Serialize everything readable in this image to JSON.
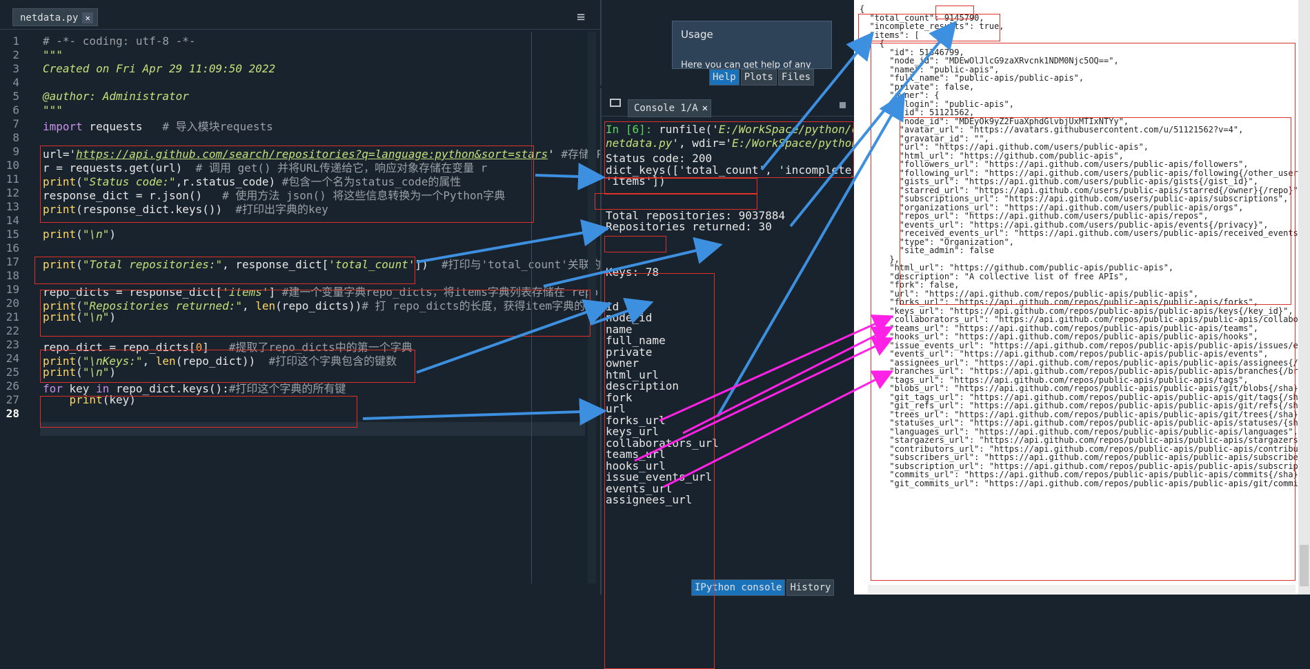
{
  "editor": {
    "tab_label": "netdata.py",
    "close_glyph": "✕",
    "menu_glyph": "≡",
    "line_numbers": [
      "1",
      "2",
      "3",
      "4",
      "5",
      "6",
      "7",
      "8",
      "9",
      "10",
      "11",
      "12",
      "13",
      "14",
      "15",
      "16",
      "17",
      "18",
      "19",
      "20",
      "21",
      "22",
      "23",
      "24",
      "25",
      "26",
      "27",
      "28"
    ],
    "lines": [
      [
        {
          "t": "# -*- coding: utf-8 -*-",
          "c": "cm"
        }
      ],
      [
        {
          "t": "\"\"\"",
          "c": "str"
        }
      ],
      [
        {
          "t": "Created on Fri Apr 29 11:09:50 2022",
          "c": "str"
        }
      ],
      [],
      [
        {
          "t": "@author: Administrator",
          "c": "str"
        }
      ],
      [
        {
          "t": "\"\"\"",
          "c": "str"
        }
      ],
      [
        {
          "t": "import",
          "c": "kw"
        },
        {
          "t": " requests   "
        },
        {
          "t": "# 导入模块requests",
          "c": "cm"
        }
      ],
      [],
      [
        {
          "t": "url="
        },
        {
          "t": "'"
        },
        {
          "t": "https://api.github.com/search/repositories?q=language:python&sort=stars",
          "c": "url"
        },
        {
          "t": "'"
        },
        {
          "t": " #存储API调",
          "c": "cm"
        }
      ],
      [
        {
          "t": "r = requests.get(url)  "
        },
        {
          "t": "# 调用 get() 并将URL传递给它，响应对象存储在变量 r",
          "c": "cm"
        }
      ],
      [
        {
          "t": "print",
          "c": "fn"
        },
        {
          "t": "("
        },
        {
          "t": "\"Status code:\"",
          "c": "str"
        },
        {
          "t": ",r.status_code) "
        },
        {
          "t": "#包含一个名为status_code的属性",
          "c": "cm"
        }
      ],
      [
        {
          "t": "response_dict = r.json()   "
        },
        {
          "t": "# 使用方法 json() 将这些信息转换为一个Python字典",
          "c": "cm"
        }
      ],
      [
        {
          "t": "print",
          "c": "fn"
        },
        {
          "t": "(response_dict.keys())  "
        },
        {
          "t": "#打印出字典的key",
          "c": "cm"
        }
      ],
      [],
      [
        {
          "t": "print",
          "c": "fn"
        },
        {
          "t": "("
        },
        {
          "t": "\"\\n\"",
          "c": "str"
        },
        {
          "t": ")"
        }
      ],
      [],
      [
        {
          "t": "print",
          "c": "fn"
        },
        {
          "t": "("
        },
        {
          "t": "\"Total repositories:\"",
          "c": "str"
        },
        {
          "t": ", response_dict["
        },
        {
          "t": "'total_count'",
          "c": "str"
        },
        {
          "t": "])  "
        },
        {
          "t": "#打印与'total_count'关联的值",
          "c": "cm"
        }
      ],
      [],
      [
        {
          "t": "repo_dicts = response_dict["
        },
        {
          "t": "'items'",
          "c": "str"
        },
        {
          "t": "] "
        },
        {
          "t": "#建一个变量字典repo_dicts，将items字典列表存储在 repo",
          "c": "cm"
        }
      ],
      [
        {
          "t": "print",
          "c": "fn"
        },
        {
          "t": "("
        },
        {
          "t": "\"Repositories returned:\"",
          "c": "str"
        },
        {
          "t": ", "
        },
        {
          "t": "len",
          "c": "fn"
        },
        {
          "t": "(repo_dicts))"
        },
        {
          "t": "# 打 repo_dicts的长度，获得item字典的长度",
          "c": "cm"
        }
      ],
      [
        {
          "t": "print",
          "c": "fn"
        },
        {
          "t": "("
        },
        {
          "t": "\"\\n\"",
          "c": "str"
        },
        {
          "t": ")"
        }
      ],
      [],
      [
        {
          "t": "repo_dict = repo_dicts["
        },
        {
          "t": "0",
          "c": "num"
        },
        {
          "t": "]   "
        },
        {
          "t": "#提取了repo_dicts中的第一个字典",
          "c": "cm"
        }
      ],
      [
        {
          "t": "print",
          "c": "fn"
        },
        {
          "t": "("
        },
        {
          "t": "\"\\nKeys:\"",
          "c": "str"
        },
        {
          "t": ", "
        },
        {
          "t": "len",
          "c": "fn"
        },
        {
          "t": "(repo_dict))  "
        },
        {
          "t": "#打印这个字典包含的键数",
          "c": "cm"
        }
      ],
      [
        {
          "t": "print",
          "c": "fn"
        },
        {
          "t": "("
        },
        {
          "t": "\"\\n\"",
          "c": "str"
        },
        {
          "t": ")"
        }
      ],
      [
        {
          "t": "for",
          "c": "kw"
        },
        {
          "t": " key "
        },
        {
          "t": "in",
          "c": "kw"
        },
        {
          "t": " repo_dict.keys():"
        },
        {
          "t": "#打印这个字典的所有键",
          "c": "cm"
        }
      ],
      [
        {
          "t": "    "
        },
        {
          "t": "print",
          "c": "fn"
        },
        {
          "t": "(key)"
        }
      ],
      []
    ]
  },
  "help": {
    "title": "Usage",
    "text": "Here you can get help of any",
    "tabs": [
      "Help",
      "Plots",
      "Files"
    ]
  },
  "console": {
    "tab_label": "Console 1/A",
    "close_glyph": "✕",
    "bottom_tabs": [
      "IPython console",
      "History"
    ],
    "run_line1_prompt": "In [6]:",
    "run_line1_rest": " runfile('",
    "run_line1_path": "E:/WorkSpace/python/cod",
    "run_line2_path": "netdata.py",
    "run_line2_mid": "', wdir='",
    "run_line2_wdir": "E:/WorkSpace/python/c",
    "output": [
      "Status code: 200",
      "dict_keys(['total_count', 'incomplete_re",
      "'items'])",
      "",
      "",
      "Total repositories: 9037884",
      "Repositories returned: 30",
      "",
      "",
      "",
      "Keys: 78",
      "",
      "",
      "id",
      "node_id",
      "name",
      "full_name",
      "private",
      "owner",
      "html_url",
      "description",
      "fork",
      "url",
      "forks_url",
      "keys_url",
      "collaborators_url",
      "teams_url",
      "hooks_url",
      "issue_events_url",
      "events_url",
      "assignees_url"
    ]
  },
  "json": {
    "lines": [
      "{",
      "  \"total_count\": 9145790,",
      "  \"incomplete_results\": true,",
      "  \"items\": [",
      "    {",
      "      \"id\": 51346799,",
      "      \"node_id\": \"MDEwOlJlcG9zaXRvcnk1NDM0Njc5OQ==\",",
      "      \"name\": \"public-apis\",",
      "      \"full_name\": \"public-apis/public-apis\",",
      "      \"private\": false,",
      "      \"owner\": {",
      "        \"login\": \"public-apis\",",
      "        \"id\": 51121562,",
      "        \"node_id\": \"MDEyOk9yZ2FuaXphdGlvbjUxMTIxNTYy\",",
      "        \"avatar_url\": \"https://avatars.githubusercontent.com/u/51121562?v=4\",",
      "        \"gravatar_id\": \"\",",
      "        \"url\": \"https://api.github.com/users/public-apis\",",
      "        \"html_url\": \"https://github.com/public-apis\",",
      "        \"followers_url\": \"https://api.github.com/users/public-apis/followers\",",
      "        \"following_url\": \"https://api.github.com/users/public-apis/following{/other_user}\",",
      "        \"gists_url\": \"https://api.github.com/users/public-apis/gists{/gist_id}\",",
      "        \"starred_url\": \"https://api.github.com/users/public-apis/starred{/owner}{/repo}\",",
      "        \"subscriptions_url\": \"https://api.github.com/users/public-apis/subscriptions\",",
      "        \"organizations_url\": \"https://api.github.com/users/public-apis/orgs\",",
      "        \"repos_url\": \"https://api.github.com/users/public-apis/repos\",",
      "        \"events_url\": \"https://api.github.com/users/public-apis/events{/privacy}\",",
      "        \"received_events_url\": \"https://api.github.com/users/public-apis/received_events\",",
      "        \"type\": \"Organization\",",
      "        \"site_admin\": false",
      "      },",
      "      \"html_url\": \"https://github.com/public-apis/public-apis\",",
      "      \"description\": \"A collective list of free APIs\",",
      "      \"fork\": false,",
      "      \"url\": \"https://api.github.com/repos/public-apis/public-apis\",",
      "      \"forks_url\": \"https://api.github.com/repos/public-apis/public-apis/forks\",",
      "      \"keys_url\": \"https://api.github.com/repos/public-apis/public-apis/keys{/key_id}\",",
      "      \"collaborators_url\": \"https://api.github.com/repos/public-apis/public-apis/collaborators\",",
      "      \"teams_url\": \"https://api.github.com/repos/public-apis/public-apis/teams\",",
      "      \"hooks_url\": \"https://api.github.com/repos/public-apis/public-apis/hooks\",",
      "      \"issue_events_url\": \"https://api.github.com/repos/public-apis/public-apis/issues/events\",",
      "      \"events_url\": \"https://api.github.com/repos/public-apis/public-apis/events\",",
      "      \"assignees_url\": \"https://api.github.com/repos/public-apis/public-apis/assignees{/user}\",",
      "      \"branches_url\": \"https://api.github.com/repos/public-apis/public-apis/branches{/branch}\",",
      "      \"tags_url\": \"https://api.github.com/repos/public-apis/public-apis/tags\",",
      "      \"blobs_url\": \"https://api.github.com/repos/public-apis/public-apis/git/blobs{/sha}\",",
      "      \"git_tags_url\": \"https://api.github.com/repos/public-apis/public-apis/git/tags{/sha}\",",
      "      \"git_refs_url\": \"https://api.github.com/repos/public-apis/public-apis/git/refs{/sha}\",",
      "      \"trees_url\": \"https://api.github.com/repos/public-apis/public-apis/git/trees{/sha}\",",
      "      \"statuses_url\": \"https://api.github.com/repos/public-apis/public-apis/statuses/{sha}\",",
      "      \"languages_url\": \"https://api.github.com/repos/public-apis/public-apis/languages\",",
      "      \"stargazers_url\": \"https://api.github.com/repos/public-apis/public-apis/stargazers\",",
      "      \"contributors_url\": \"https://api.github.com/repos/public-apis/public-apis/contributors\",",
      "      \"subscribers_url\": \"https://api.github.com/repos/public-apis/public-apis/subscribers\",",
      "      \"subscription_url\": \"https://api.github.com/repos/public-apis/public-apis/subscription\",",
      "      \"commits_url\": \"https://api.github.com/repos/public-apis/public-apis/commits{/sha}\",",
      "      \"git_commits_url\": \"https://api.github.com/repos/public-apis/public-apis/git/commits{/sha}\","
    ]
  },
  "colors": {
    "annotation_box": "#e0302a",
    "arrow_blue": "#3d8fdf",
    "arrow_magenta": "#ff22e6"
  }
}
